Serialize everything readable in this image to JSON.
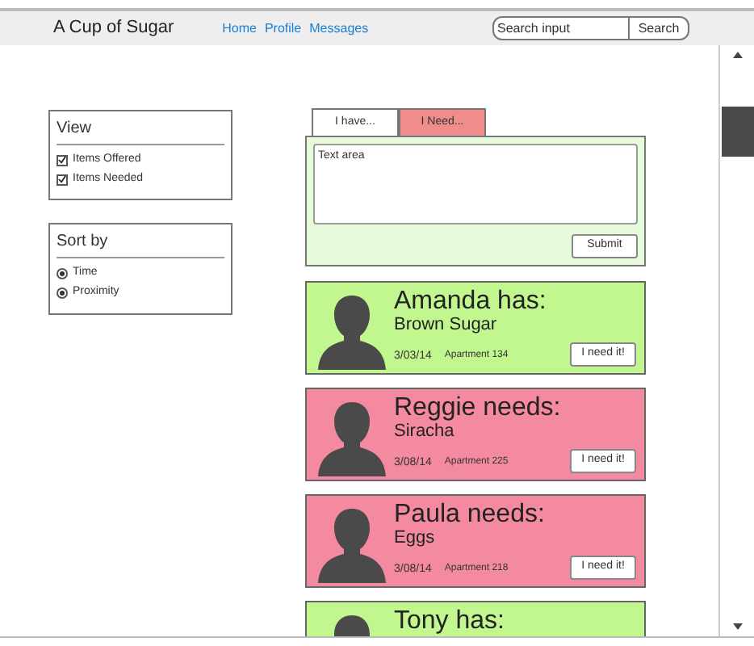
{
  "header": {
    "logo": "A Cup of Sugar",
    "nav": [
      {
        "label": "Home"
      },
      {
        "label": "Profile"
      },
      {
        "label": "Messages"
      }
    ],
    "search": {
      "placeholder": "Search input",
      "button": "Search"
    }
  },
  "view": {
    "title": "View",
    "options": [
      {
        "label": "Items Offered",
        "checked": true
      },
      {
        "label": "Items Needed",
        "checked": true
      }
    ]
  },
  "sort": {
    "title": "Sort by",
    "options": [
      {
        "label": "Time",
        "selected": true
      },
      {
        "label": "Proximity",
        "selected": true
      }
    ]
  },
  "post_form": {
    "tabs": [
      {
        "label": "I have...",
        "selected": true
      },
      {
        "label": "I Need...",
        "selected": false
      }
    ],
    "placeholder": "Text area",
    "submit": "Submit"
  },
  "posts": [
    {
      "kind": "has",
      "title": "Amanda has:",
      "item": "Brown Sugar",
      "date": "3/03/14",
      "location": "Apartment 134",
      "button": "I need it!"
    },
    {
      "kind": "needs",
      "title": "Reggie needs:",
      "item": "Siracha",
      "date": "3/08/14",
      "location": "Apartment 225",
      "button": "I need it!"
    },
    {
      "kind": "needs",
      "title": "Paula needs:",
      "item": "Eggs",
      "date": "3/08/14",
      "location": "Apartment 218",
      "button": "I need it!"
    },
    {
      "kind": "has",
      "title": "Tony has:"
    }
  ]
}
